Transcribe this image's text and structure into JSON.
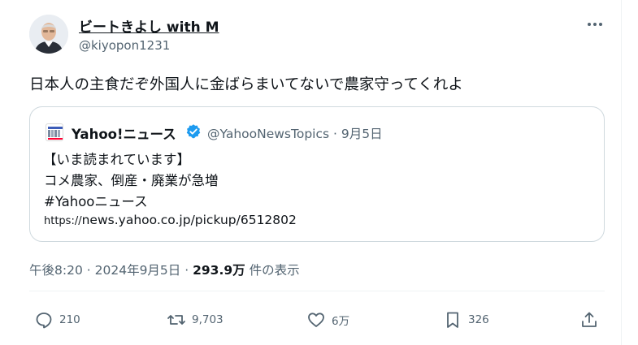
{
  "author": {
    "name": "ビートきよし with M",
    "handle": "@kiyopon1231"
  },
  "tweet": {
    "text": "日本人の主食だぞ外国人に金ばらまいてないで農家守ってくれよ"
  },
  "quote": {
    "name": "Yahoo!ニュース",
    "handle": "@YahooNewsTopics",
    "separator": "·",
    "date": "9月5日",
    "line1": "【いま読まれています】",
    "line2": "コメ農家、倒産・廃業が急増",
    "line3": "#Yahooニュース",
    "url_protocol": "https://",
    "url_rest": "news.yahoo.co.jp/pickup/6512802"
  },
  "meta": {
    "time": "午後8:20",
    "sep1": "·",
    "date": "2024年9月5日",
    "sep2": "·",
    "views": "293.9万",
    "views_label": "件の表示"
  },
  "actions": {
    "replies": "210",
    "retweets": "9,703",
    "likes": "6万",
    "bookmarks": "326"
  },
  "icons": {
    "more": "more-horizontal-icon",
    "verified": "verified-badge-icon",
    "reply": "reply-icon",
    "retweet": "retweet-icon",
    "like": "heart-icon",
    "bookmark": "bookmark-icon",
    "share": "share-icon"
  },
  "colors": {
    "text": "#0f1419",
    "secondary": "#536471",
    "border": "#cfd9de",
    "verified": "#1d9bf0"
  }
}
